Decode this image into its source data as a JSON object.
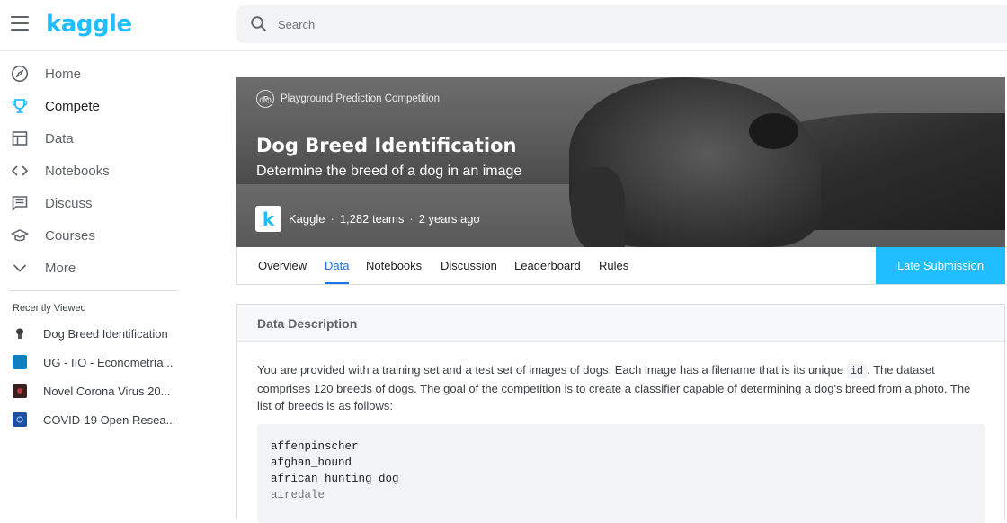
{
  "app": {
    "logo_text": "kaggle",
    "brand_color": "#20beff"
  },
  "search": {
    "placeholder": "Search"
  },
  "sidebar": {
    "items": [
      {
        "label": "Home",
        "icon": "compass-icon"
      },
      {
        "label": "Compete",
        "icon": "trophy-icon",
        "active": true
      },
      {
        "label": "Data",
        "icon": "table-icon"
      },
      {
        "label": "Notebooks",
        "icon": "code-icon"
      },
      {
        "label": "Discuss",
        "icon": "comment-icon"
      },
      {
        "label": "Courses",
        "icon": "graduation-cap-icon"
      },
      {
        "label": "More",
        "icon": "chevron-down-icon"
      }
    ],
    "recent_title": "Recently Viewed",
    "recent": [
      {
        "label": "Dog Breed Identification",
        "thumb_color": "#ffffff"
      },
      {
        "label": "UG - IIO - Econometría...",
        "thumb_color": "#0e7fc0"
      },
      {
        "label": "Novel Corona Virus 20...",
        "thumb_color": "#3a1f1f"
      },
      {
        "label": "COVID-19 Open Resea...",
        "thumb_color": "#1d4fa3"
      }
    ]
  },
  "competition": {
    "category": "Playground Prediction Competition",
    "title": "Dog Breed Identification",
    "subtitle": "Determine the breed of a dog in an image",
    "host": "Kaggle",
    "teams": "1,282 teams",
    "age": "2 years ago"
  },
  "tabs": [
    "Overview",
    "Data",
    "Notebooks",
    "Discussion",
    "Leaderboard",
    "Rules"
  ],
  "active_tab": "Data",
  "late_submission_label": "Late Submission",
  "data_description": {
    "heading": "Data Description",
    "text_before_code": "You are provided with a training set and a test set of images of dogs. Each image has a filename that is its unique ",
    "inline_code": "id",
    "text_after_code": ". The dataset comprises 120 breeds of dogs. The goal of the competition is to create a classifier capable of determining a dog's breed from a photo. The list of breeds is as follows:",
    "breeds": [
      "affenpinscher",
      "afghan_hound",
      "african_hunting_dog",
      "airedale"
    ]
  }
}
